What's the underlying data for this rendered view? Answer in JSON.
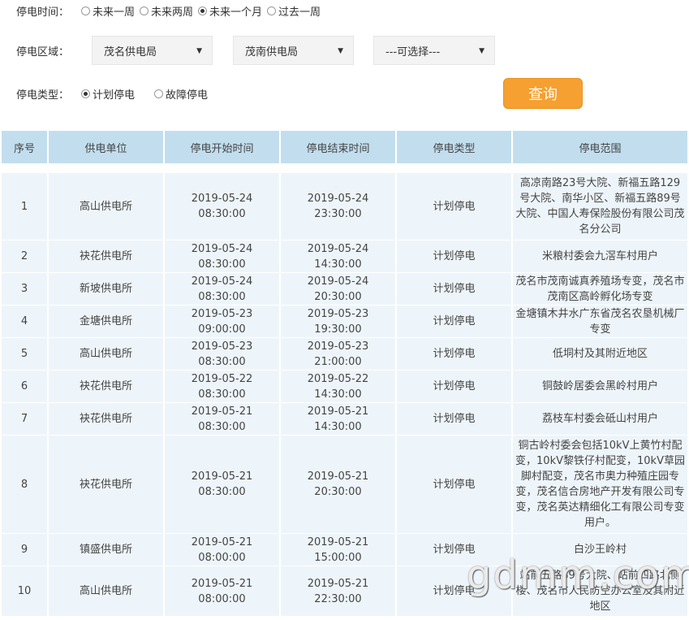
{
  "filters": {
    "time": {
      "label": "停电时间：",
      "options": [
        {
          "label": "未来一周",
          "selected": false
        },
        {
          "label": "未来两周",
          "selected": false
        },
        {
          "label": "未来一个月",
          "selected": true
        },
        {
          "label": "过去一周",
          "selected": false
        }
      ]
    },
    "area": {
      "label": "停电区域：",
      "select1": "茂名供电局",
      "select2": "茂南供电局",
      "select3": "---可选择---"
    },
    "type": {
      "label": "停电类型：",
      "options": [
        {
          "label": "计划停电",
          "selected": true
        },
        {
          "label": "故障停电",
          "selected": false
        }
      ]
    }
  },
  "query_button": "查询",
  "table": {
    "headers": [
      "序号",
      "供电单位",
      "停电开始时间",
      "停电结束时间",
      "停电类型",
      "停电范围"
    ],
    "rows": [
      {
        "no": "1",
        "unit": "高山供电所",
        "start": "2019-05-24 08:30:00",
        "end": "2019-05-24 23:30:00",
        "type": "计划停电",
        "range": "高凉南路23号大院、新福五路129号大院、南华小区、新福五路89号大院、中国人寿保险股份有限公司茂名分公司"
      },
      {
        "no": "2",
        "unit": "袂花供电所",
        "start": "2019-05-24 08:30:00",
        "end": "2019-05-24 14:30:00",
        "type": "计划停电",
        "range": "米粮村委会九滘车村用户"
      },
      {
        "no": "3",
        "unit": "新坡供电所",
        "start": "2019-05-24 08:30:00",
        "end": "2019-05-24 20:30:00",
        "type": "计划停电",
        "range": "茂名市茂南诚真养殖场专变，茂名市茂南区高岭孵化场专变"
      },
      {
        "no": "4",
        "unit": "金塘供电所",
        "start": "2019-05-23 09:00:00",
        "end": "2019-05-23 19:30:00",
        "type": "计划停电",
        "range": "金塘镇木井水广东省茂名农垦机械厂专变"
      },
      {
        "no": "5",
        "unit": "高山供电所",
        "start": "2019-05-23 08:30:00",
        "end": "2019-05-23 21:00:00",
        "type": "计划停电",
        "range": "低垌村及其附近地区"
      },
      {
        "no": "6",
        "unit": "袂花供电所",
        "start": "2019-05-22 08:30:00",
        "end": "2019-05-22 14:30:00",
        "type": "计划停电",
        "range": "铜鼓岭居委会黑岭村用户"
      },
      {
        "no": "7",
        "unit": "袂花供电所",
        "start": "2019-05-21 08:30:00",
        "end": "2019-05-21 14:30:00",
        "type": "计划停电",
        "range": "荔枝车村委会砥山村用户"
      },
      {
        "no": "8",
        "unit": "袂花供电所",
        "start": "2019-05-21 08:30:00",
        "end": "2019-05-21 20:30:00",
        "type": "计划停电",
        "range": "铜古岭村委会包括10kV上黄竹村配变，10kV黎铁仔村配变，10kV草园脚村配变，茂名市奥力种殖庄园专变，茂名信合房地产开发有限公司专变，茂名英达精细化工有限公司专变用户。"
      },
      {
        "no": "9",
        "unit": "镇盛供电所",
        "start": "2019-05-21 08:00:00",
        "end": "2019-05-21 15:00:00",
        "type": "计划停电",
        "range": "白沙王岭村"
      },
      {
        "no": "10",
        "unit": "高山供电所",
        "start": "2019-05-21 08:00:00",
        "end": "2019-05-21 22:30:00",
        "type": "计划停电",
        "range": "站前五路89号大院、站前四路北侧楼、茂名市人民防空办公室及其附近地区"
      }
    ]
  },
  "watermark": "gdmm.com"
}
